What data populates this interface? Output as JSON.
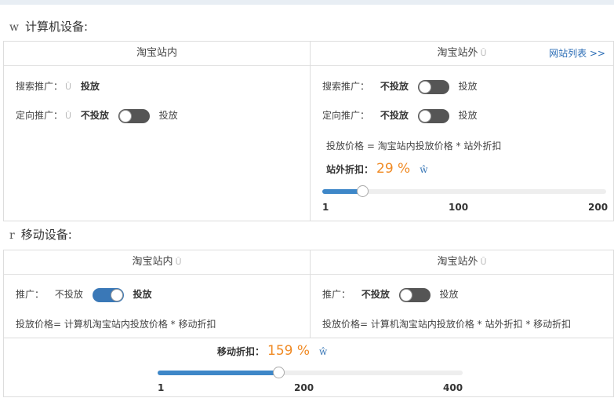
{
  "desktop": {
    "title": "计算机设备:",
    "icon": "w",
    "inner": {
      "head": "淘宝站内",
      "search_label": "搜索推广：",
      "search_value": "投放",
      "target_label": "定向推广：",
      "target_off": "不投放",
      "target_on": "投放",
      "target_state": "off"
    },
    "outer": {
      "head": "淘宝站外",
      "sites_link": "网站列表 >>",
      "search_label": "搜索推广：",
      "search_off": "不投放",
      "search_on": "投放",
      "search_state": "off",
      "target_label": "定向推广：",
      "target_off": "不投放",
      "target_on": "投放",
      "target_state": "off",
      "formula": "投放价格 = 淘宝站内投放价格 * 站外折扣",
      "discount_label": "站外折扣：",
      "discount_value": "29 %",
      "help_icon": "ŵ",
      "slider": {
        "min": 1,
        "max": 200,
        "value": 29,
        "ticks": [
          "1",
          "100",
          "200"
        ]
      }
    }
  },
  "mobile": {
    "title": "移动设备:",
    "icon": "r",
    "inner": {
      "head": "淘宝站内",
      "promo_label": "推广：",
      "promo_off": "不投放",
      "promo_on": "投放",
      "promo_state": "on",
      "formula": "投放价格= 计算机淘宝站内投放价格 * 移动折扣"
    },
    "outer": {
      "head": "淘宝站外",
      "promo_label": "推广：",
      "promo_off": "不投放",
      "promo_on": "投放",
      "promo_state": "off",
      "formula": "投放价格= 计算机淘宝站内投放价格 * 站外折扣 * 移动折扣"
    },
    "discount_label": "移动折扣：",
    "discount_value": "159 %",
    "help_icon": "ŵ",
    "slider": {
      "min": 1,
      "max": 400,
      "value": 159,
      "ticks": [
        "1",
        "200",
        "400"
      ]
    }
  },
  "hint_char": "Û",
  "colors": {
    "accent": "#3e87c8",
    "orange": "#f08a24",
    "link": "#2a6cb5"
  }
}
